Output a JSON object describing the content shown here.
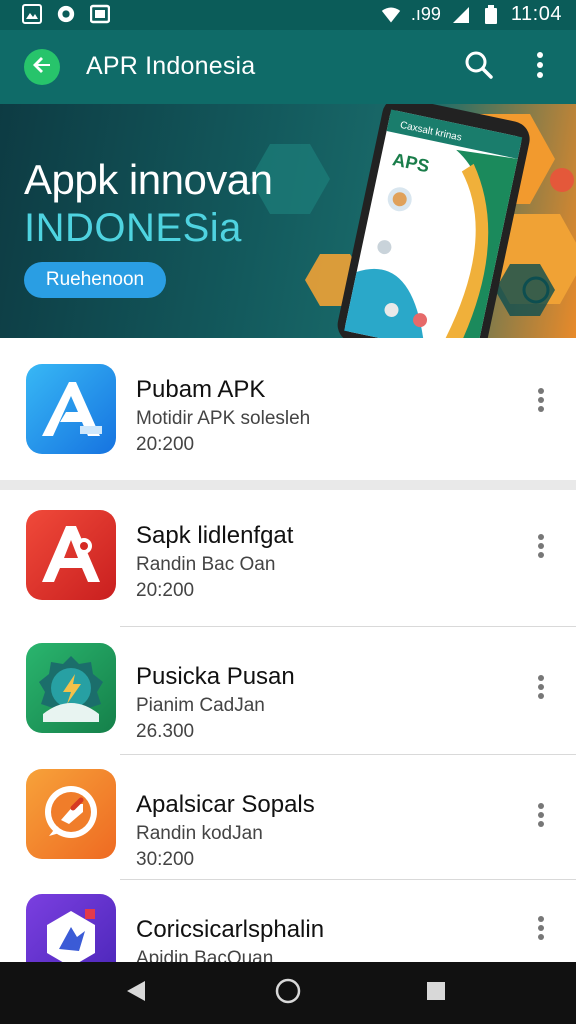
{
  "status_bar": {
    "left_icons": [
      "gallery-icon",
      "camera-icon",
      "image-icon"
    ],
    "signal_text": ".ı99",
    "time": "11:04",
    "right_icons": [
      "wifi-icon",
      "cell-signal-icon",
      "battery-icon"
    ]
  },
  "app_bar": {
    "title": "APR Indonesia",
    "icons": [
      "back-arrow-icon",
      "search-icon",
      "more-vert-icon"
    ],
    "background": "#0f6b68",
    "back_button_color": "#27c46b"
  },
  "banner": {
    "title_line_1": "Appk innovan",
    "title_line_2": "INDONESia",
    "button_label": "Ruehenoon",
    "phone_header": "Caxsalt krinas",
    "phone_logo": "APS"
  },
  "apps": [
    {
      "name": "Pubam APK",
      "subtitle": "Motidir APK solesleh",
      "size": "20:200",
      "icon": "app-store-a-icon",
      "color": "#1a8fe8"
    },
    {
      "name": "Sapk lidlenfgat",
      "subtitle": "Randin Bac Oan",
      "size": "20:200",
      "icon": "red-a-icon",
      "color": "#e23a2a"
    },
    {
      "name": "Pusicka Pusan",
      "subtitle": "Pianim CadJan",
      "size": "26.300",
      "icon": "green-badge-icon",
      "color": "#1f9f5e"
    },
    {
      "name": "Apalsicar Sopals",
      "subtitle": "Randin kodJan",
      "size": "30:200",
      "icon": "orange-chat-icon",
      "color": "#f2802a"
    },
    {
      "name": "Coricsicarlsphalin",
      "subtitle": "Apidin BacOuan",
      "size": "",
      "icon": "purple-hex-icon",
      "color": "#6a3fd0"
    }
  ],
  "nav_bar": {
    "icons": [
      "back-triangle-icon",
      "home-circle-icon",
      "recents-square-icon"
    ]
  }
}
